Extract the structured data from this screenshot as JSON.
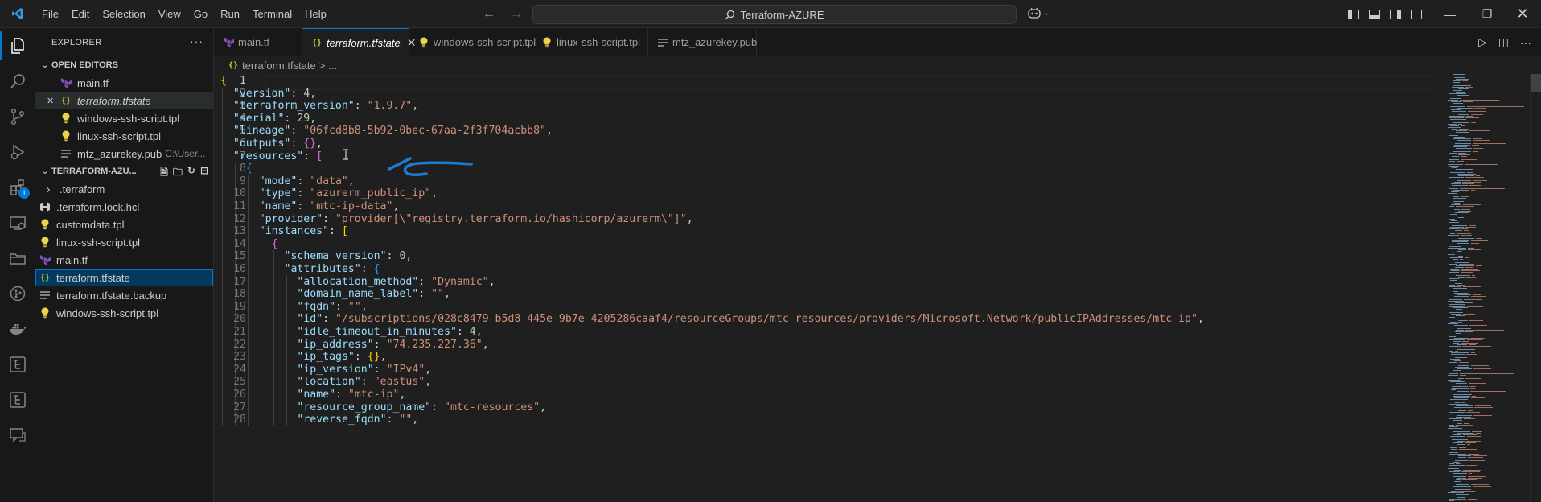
{
  "titlebar": {
    "menu": [
      "File",
      "Edit",
      "Selection",
      "View",
      "Go",
      "Run",
      "Terminal",
      "Help"
    ],
    "search_text": "Terraform-AZURE"
  },
  "explorer": {
    "title": "EXPLORER",
    "open_editors_label": "OPEN EDITORS",
    "open_editors": [
      {
        "name": "main.tf",
        "icon": "terraform-icon",
        "italic": false,
        "desc": ""
      },
      {
        "name": "terraform.tfstate",
        "icon": "json-braces-icon",
        "italic": true,
        "desc": ""
      },
      {
        "name": "windows-ssh-script.tpl",
        "icon": "lightbulb-icon",
        "italic": false,
        "desc": ""
      },
      {
        "name": "linux-ssh-script.tpl",
        "icon": "lightbulb-icon",
        "italic": false,
        "desc": ""
      },
      {
        "name": "mtz_azurekey.pub",
        "icon": "lines-icon",
        "italic": false,
        "desc": "C:\\User..."
      }
    ],
    "folder_label": "TERRAFORM-AZU...",
    "files": [
      {
        "name": ".terraform",
        "icon": "folder-chevron",
        "indent": 1
      },
      {
        "name": ".terraform.lock.hcl",
        "icon": "hcl-icon",
        "indent": 0
      },
      {
        "name": "customdata.tpl",
        "icon": "lightbulb-icon",
        "indent": 0
      },
      {
        "name": "linux-ssh-script.tpl",
        "icon": "lightbulb-icon",
        "indent": 0
      },
      {
        "name": "main.tf",
        "icon": "terraform-icon",
        "indent": 0
      },
      {
        "name": "terraform.tfstate",
        "icon": "json-braces-icon",
        "indent": 0
      },
      {
        "name": "terraform.tfstate.backup",
        "icon": "lines-icon",
        "indent": 0
      },
      {
        "name": "windows-ssh-script.tpl",
        "icon": "lightbulb-icon",
        "indent": 0
      }
    ],
    "extensions_badge": "1"
  },
  "tabs": [
    {
      "label": "main.tf",
      "icon": "terraform-icon"
    },
    {
      "label": "terraform.tfstate",
      "icon": "json-braces-icon",
      "active": true
    },
    {
      "label": "windows-ssh-script.tpl",
      "icon": "lightbulb-icon"
    },
    {
      "label": "linux-ssh-script.tpl",
      "icon": "lightbulb-icon"
    },
    {
      "label": "mtz_azurekey.pub",
      "icon": "lines-icon"
    }
  ],
  "breadcrumb": {
    "file": "terraform.tfstate",
    "separator": ">",
    "more": "..."
  },
  "editor": {
    "current_line": 1,
    "lines": [
      [
        [
          "b1",
          "{"
        ]
      ],
      [
        [
          "k",
          "\"version\""
        ],
        [
          "p",
          ": "
        ],
        [
          "n",
          "4"
        ],
        [
          "p",
          ","
        ]
      ],
      [
        [
          "k",
          "\"terraform_version\""
        ],
        [
          "p",
          ": "
        ],
        [
          "s",
          "\"1.9.7\""
        ],
        [
          "p",
          ","
        ]
      ],
      [
        [
          "k",
          "\"serial\""
        ],
        [
          "p",
          ": "
        ],
        [
          "n",
          "29"
        ],
        [
          "p",
          ","
        ]
      ],
      [
        [
          "k",
          "\"lineage\""
        ],
        [
          "p",
          ": "
        ],
        [
          "s",
          "\"06fcd8b8-5b92-0bec-67aa-2f3f704acbb8\""
        ],
        [
          "p",
          ","
        ]
      ],
      [
        [
          "k",
          "\"outputs\""
        ],
        [
          "p",
          ": "
        ],
        [
          "b2",
          "{}"
        ],
        [
          "p",
          ","
        ]
      ],
      [
        [
          "k",
          "\"resources\""
        ],
        [
          "p",
          ": "
        ],
        [
          "b2",
          "["
        ]
      ],
      [
        [
          "b3",
          "{"
        ]
      ],
      [
        [
          "k",
          "\"mode\""
        ],
        [
          "p",
          ": "
        ],
        [
          "s",
          "\"data\""
        ],
        [
          "p",
          ","
        ]
      ],
      [
        [
          "k",
          "\"type\""
        ],
        [
          "p",
          ": "
        ],
        [
          "s",
          "\"azurerm_public_ip\""
        ],
        [
          "p",
          ","
        ]
      ],
      [
        [
          "k",
          "\"name\""
        ],
        [
          "p",
          ": "
        ],
        [
          "s",
          "\"mtc-ip-data\""
        ],
        [
          "p",
          ","
        ]
      ],
      [
        [
          "k",
          "\"provider\""
        ],
        [
          "p",
          ": "
        ],
        [
          "s",
          "\"provider[\\\"registry.terraform.io/hashicorp/azurerm\\\"]\""
        ],
        [
          "p",
          ","
        ]
      ],
      [
        [
          "k",
          "\"instances\""
        ],
        [
          "p",
          ": "
        ],
        [
          "b1",
          "["
        ]
      ],
      [
        [
          "b2",
          "{"
        ]
      ],
      [
        [
          "k",
          "\"schema_version\""
        ],
        [
          "p",
          ": "
        ],
        [
          "n",
          "0"
        ],
        [
          "p",
          ","
        ]
      ],
      [
        [
          "k",
          "\"attributes\""
        ],
        [
          "p",
          ": "
        ],
        [
          "b3",
          "{"
        ]
      ],
      [
        [
          "k",
          "\"allocation_method\""
        ],
        [
          "p",
          ": "
        ],
        [
          "s",
          "\"Dynamic\""
        ],
        [
          "p",
          ","
        ]
      ],
      [
        [
          "k",
          "\"domain_name_label\""
        ],
        [
          "p",
          ": "
        ],
        [
          "s",
          "\"\""
        ],
        [
          "p",
          ","
        ]
      ],
      [
        [
          "k",
          "\"fqdn\""
        ],
        [
          "p",
          ": "
        ],
        [
          "s",
          "\"\""
        ],
        [
          "p",
          ","
        ]
      ],
      [
        [
          "k",
          "\"id\""
        ],
        [
          "p",
          ": "
        ],
        [
          "s",
          "\"/subscriptions/028c8479-b5d8-445e-9b7e-4205286caaf4/resourceGroups/mtc-resources/providers/Microsoft.Network/publicIPAddresses/mtc-ip\""
        ],
        [
          "p",
          ","
        ]
      ],
      [
        [
          "k",
          "\"idle_timeout_in_minutes\""
        ],
        [
          "p",
          ": "
        ],
        [
          "n",
          "4"
        ],
        [
          "p",
          ","
        ]
      ],
      [
        [
          "k",
          "\"ip_address\""
        ],
        [
          "p",
          ": "
        ],
        [
          "s",
          "\"74.235.227.36\""
        ],
        [
          "p",
          ","
        ]
      ],
      [
        [
          "k",
          "\"ip_tags\""
        ],
        [
          "p",
          ": "
        ],
        [
          "b1",
          "{}"
        ],
        [
          "p",
          ","
        ]
      ],
      [
        [
          "k",
          "\"ip_version\""
        ],
        [
          "p",
          ": "
        ],
        [
          "s",
          "\"IPv4\""
        ],
        [
          "p",
          ","
        ]
      ],
      [
        [
          "k",
          "\"location\""
        ],
        [
          "p",
          ": "
        ],
        [
          "s",
          "\"eastus\""
        ],
        [
          "p",
          ","
        ]
      ],
      [
        [
          "k",
          "\"name\""
        ],
        [
          "p",
          ": "
        ],
        [
          "s",
          "\"mtc-ip\""
        ],
        [
          "p",
          ","
        ]
      ],
      [
        [
          "k",
          "\"resource_group_name\""
        ],
        [
          "p",
          ": "
        ],
        [
          "s",
          "\"mtc-resources\""
        ],
        [
          "p",
          ","
        ]
      ],
      [
        [
          "k",
          "\"reverse_fqdn\""
        ],
        [
          "p",
          ": "
        ],
        [
          "s",
          "\"\""
        ],
        [
          "p",
          ","
        ]
      ]
    ],
    "indents": [
      0,
      1,
      1,
      1,
      1,
      1,
      1,
      2,
      3,
      3,
      3,
      3,
      3,
      4,
      5,
      5,
      6,
      6,
      6,
      6,
      6,
      6,
      6,
      6,
      6,
      6,
      6,
      6
    ]
  },
  "colors": {
    "accent": "#0078d4",
    "annotation_arrow": "#1f7ad1"
  }
}
